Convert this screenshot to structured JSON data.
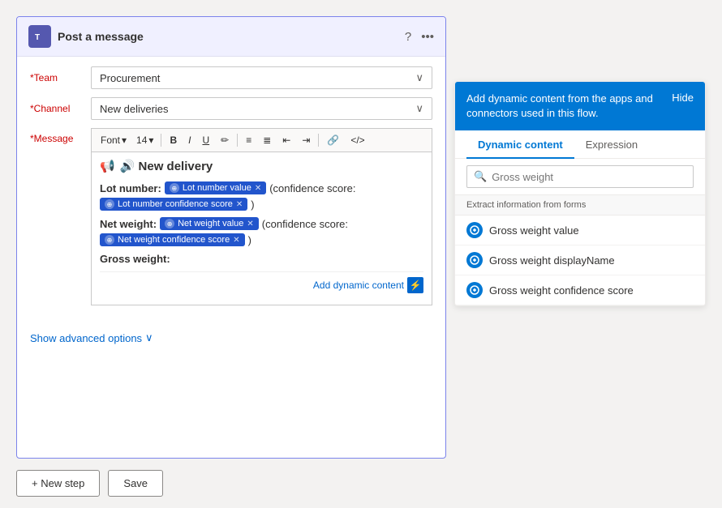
{
  "card": {
    "title": "Post a message",
    "help_icon": "?",
    "more_icon": "···"
  },
  "form": {
    "team_label": "*Team",
    "team_value": "Procurement",
    "channel_label": "*Channel",
    "channel_value": "New deliveries",
    "message_label": "*Message"
  },
  "toolbar": {
    "font_label": "Font",
    "size_label": "14",
    "bold": "B",
    "italic": "I",
    "underline": "U",
    "highlight": "✏",
    "bullets_ordered": "≡",
    "bullets_unordered": "≡",
    "indent_decrease": "⇤",
    "indent_increase": "⇥",
    "link": "🔗",
    "code_inline": "</>",
    "more": "⚡"
  },
  "editor": {
    "heading": "🔊 New delivery",
    "lot_number_label": "Lot number:",
    "lot_number_tag": "Lot number value",
    "confidence_text": "(confidence score:",
    "lot_confidence_tag": "Lot number confidence score",
    "close_bracket": ")",
    "net_weight_label": "Net weight:",
    "net_weight_tag": "Net weight value",
    "net_confidence_tag": "Net weight confidence score",
    "gross_weight_label": "Gross weight:",
    "add_dynamic_label": "Add dynamic content"
  },
  "show_advanced": "Show advanced options",
  "bottom": {
    "new_step_label": "+ New step",
    "save_label": "Save"
  },
  "right_panel": {
    "header_text": "Add dynamic content from the apps and connectors used in this flow.",
    "hide_label": "Hide",
    "tab_dynamic": "Dynamic content",
    "tab_expression": "Expression",
    "search_placeholder": "Gross weight",
    "section_label": "Extract information from forms",
    "items": [
      {
        "label": "Gross weight value"
      },
      {
        "label": "Gross weight displayName"
      },
      {
        "label": "Gross weight confidence score"
      }
    ]
  }
}
